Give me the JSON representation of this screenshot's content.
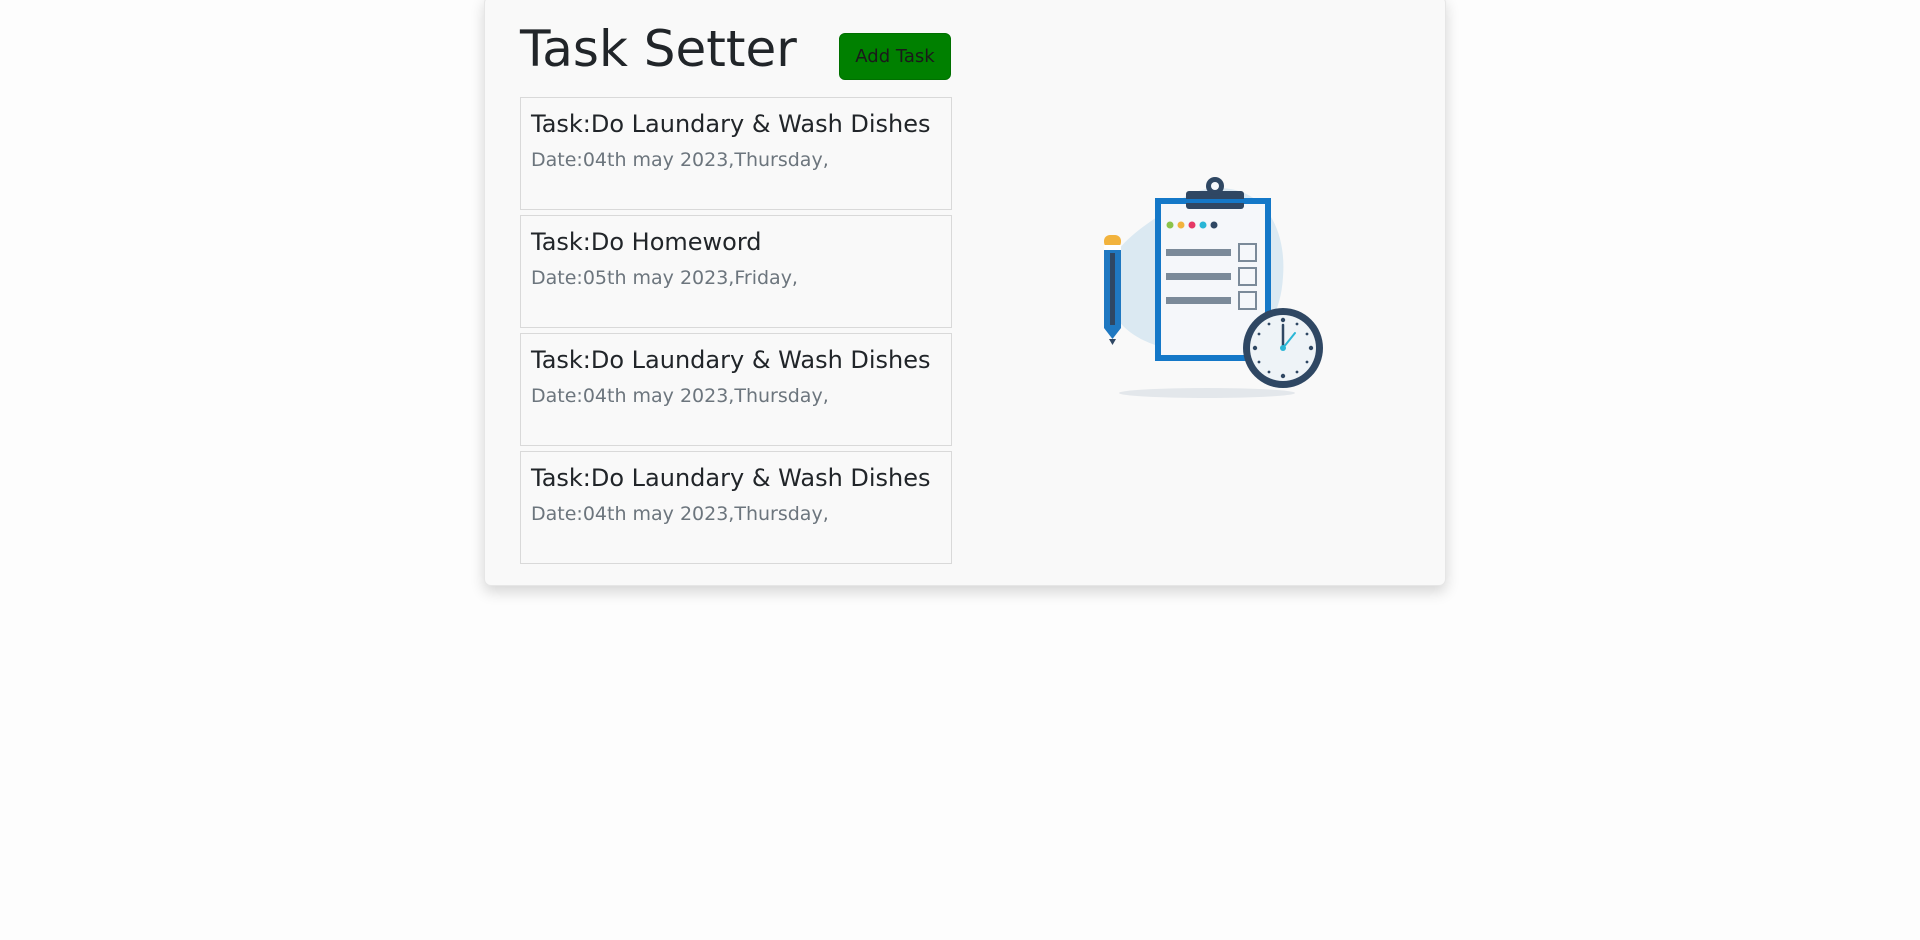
{
  "app": {
    "title": "Task Setter",
    "add_button_label": "Add Task"
  },
  "tasks": [
    {
      "task": "Task:Do Laundary & Wash Dishes",
      "date": "Date:04th may 2023,Thursday,"
    },
    {
      "task": "Task:Do Homeword",
      "date": "Date:05th may 2023,Friday,"
    },
    {
      "task": "Task:Do Laundary & Wash Dishes",
      "date": "Date:04th may 2023,Thursday,"
    },
    {
      "task": "Task:Do Laundary & Wash Dishes",
      "date": "Date:04th may 2023,Thursday,"
    }
  ],
  "illustration": {
    "icon": "clipboard-checklist-clock-icon",
    "colors": {
      "blob": "#dbe9f2",
      "clipboard_border": "#1478c8",
      "dark": "#2f4763",
      "lines": "#7b8a99",
      "pencil_body": "#1f78c1",
      "pencil_tip": "#f2b33d",
      "clock_accent": "#29b6d6"
    }
  },
  "colors": {
    "button": "#008000",
    "card_background": "#f9f9f9"
  }
}
